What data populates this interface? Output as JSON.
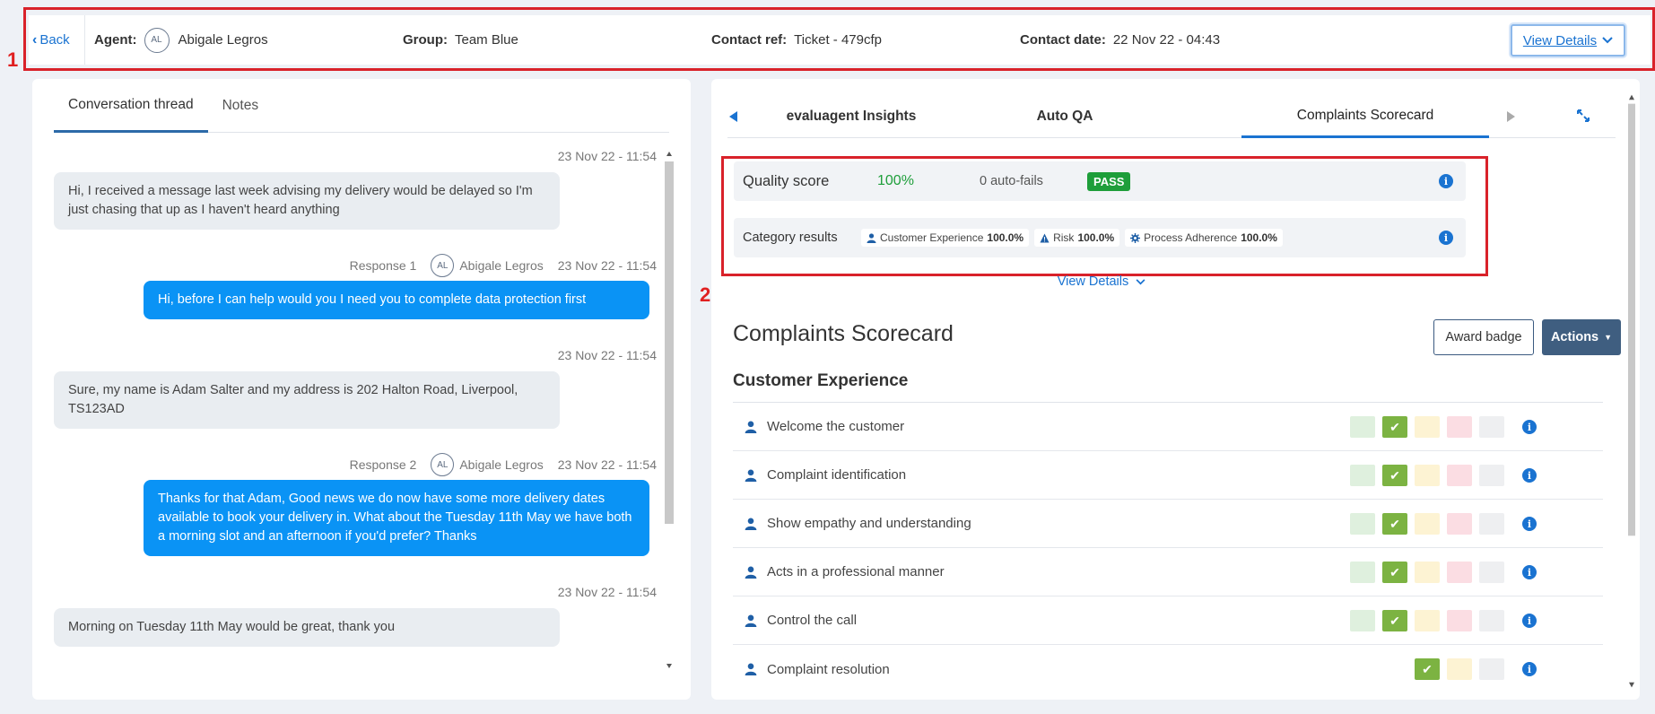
{
  "annotations": {
    "one": "1",
    "two": "2"
  },
  "header": {
    "back": "Back",
    "agent_label": "Agent:",
    "agent_initials": "AL",
    "agent_name": "Abigale Legros",
    "group_label": "Group:",
    "group_value": "Team Blue",
    "contact_ref_label": "Contact ref:",
    "contact_ref_value": "Ticket - 479cfp",
    "contact_date_label": "Contact date:",
    "contact_date_value": "22 Nov 22 - 04:43",
    "view_details": "View Details"
  },
  "left_panel": {
    "tabs": [
      "Conversation thread",
      "Notes"
    ],
    "messages": [
      {
        "time": "23 Nov 22 - 11:54",
        "text": "Hi, I received a message last week advising my delivery would be delayed so I'm just chasing that up as I haven't heard anything"
      },
      {
        "time": "23 Nov 22 - 11:54",
        "response": "Response 1",
        "initials": "AL",
        "agent": "Abigale Legros",
        "text": "Hi, before I can help would you I need you to complete data protection first"
      },
      {
        "time": "23 Nov 22 - 11:54",
        "text": "Sure, my name is Adam Salter and my address is 202 Halton Road, Liverpool, TS123AD"
      },
      {
        "time": "23 Nov 22 - 11:54",
        "response": "Response 2",
        "initials": "AL",
        "agent": "Abigale Legros",
        "text": "Thanks for that Adam, Good news we do now have some more delivery dates available to book your delivery in. What about the Tuesday 11th May we have both a morning slot and an afternoon if you'd prefer? Thanks"
      },
      {
        "time": "23 Nov 22 - 11:54",
        "text": "Morning on Tuesday 11th May would be great, thank you"
      }
    ]
  },
  "right_panel": {
    "tabs": [
      "evaluagent Insights",
      "Auto QA",
      "Complaints Scorecard"
    ],
    "quality_score_label": "Quality score",
    "quality_score_value": "100%",
    "auto_fails": "0 auto-fails",
    "pass_badge": "PASS",
    "category_results_label": "Category results",
    "categories": [
      {
        "icon": "person-icon",
        "name": "Customer Experience",
        "value": "100.0%"
      },
      {
        "icon": "warning-icon",
        "name": "Risk",
        "value": "100.0%"
      },
      {
        "icon": "gear-icon",
        "name": "Process Adherence",
        "value": "100.0%"
      }
    ],
    "view_details": "View Details",
    "scorecard_title": "Complaints Scorecard",
    "award_badge": "Award badge",
    "actions": "Actions",
    "section_title": "Customer Experience",
    "rows": [
      {
        "label": "Welcome the customer",
        "selected": "pass"
      },
      {
        "label": "Complaint identification",
        "selected": "pass"
      },
      {
        "label": "Show empathy and understanding",
        "selected": "pass"
      },
      {
        "label": "Acts in a professional manner",
        "selected": "pass"
      },
      {
        "label": "Control the call",
        "selected": "pass"
      },
      {
        "label": "Complaint resolution",
        "selected": "pass"
      }
    ]
  },
  "colors": {
    "accent": "#1a73d1",
    "bubble_out": "#0a93f5",
    "pass_green": "#1e9e3a",
    "score_green": "#1e9e3a",
    "annotation_red": "#d9222a",
    "actions_btn": "#3f5e80"
  }
}
